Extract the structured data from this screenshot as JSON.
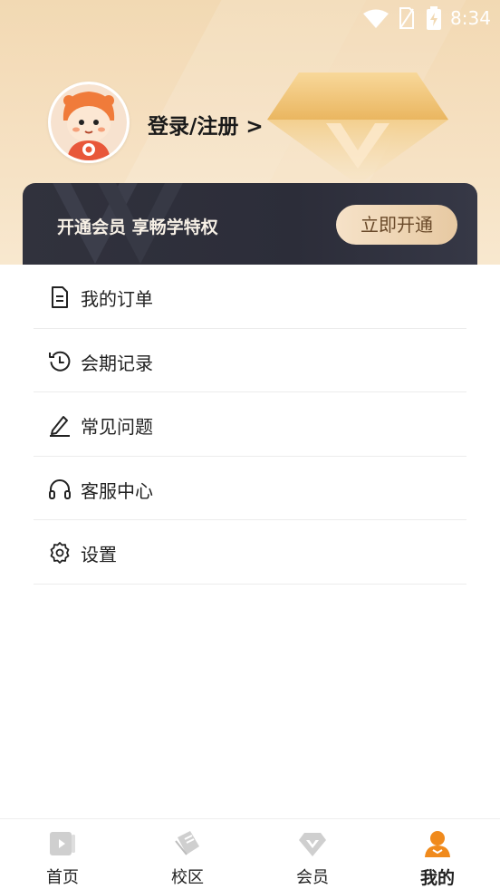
{
  "status_bar": {
    "time": "8:34"
  },
  "header": {
    "login_label": "登录/注册 >"
  },
  "vip_card": {
    "text": "开通会员 享畅学特权",
    "button_label": "立即开通"
  },
  "menu": {
    "items": [
      {
        "label": "我的订单",
        "icon": "document-icon"
      },
      {
        "label": "会期记录",
        "icon": "history-icon"
      },
      {
        "label": "常见问题",
        "icon": "pencil-icon"
      },
      {
        "label": "客服中心",
        "icon": "headset-icon"
      },
      {
        "label": "设置",
        "icon": "gear-icon"
      }
    ]
  },
  "tabbar": {
    "tabs": [
      {
        "label": "首页",
        "icon": "video-icon"
      },
      {
        "label": "校区",
        "icon": "book-icon"
      },
      {
        "label": "会员",
        "icon": "diamond-icon"
      },
      {
        "label": "我的",
        "icon": "user-icon",
        "active": true
      }
    ]
  },
  "colors": {
    "accent": "#f08a1c",
    "header_bg": "#f2d9b3",
    "vip_card_bg": "#31323d",
    "vip_button": "#eed4b2"
  }
}
